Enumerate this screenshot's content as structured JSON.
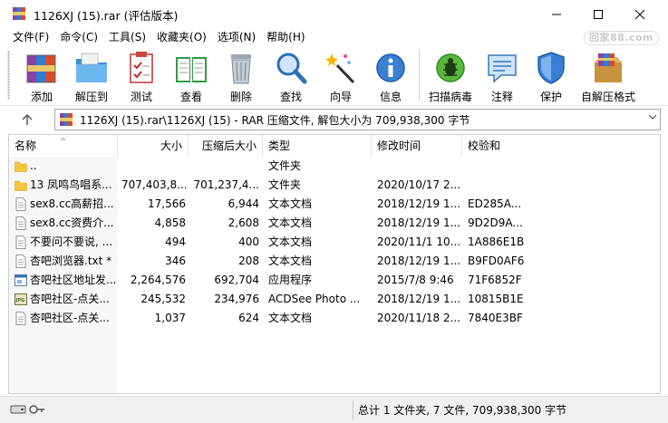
{
  "window": {
    "title": "1126XJ (15).rar (评估版本)",
    "watermark": "回家88.com"
  },
  "menu": [
    "文件(F)",
    "命令(C)",
    "工具(S)",
    "收藏夹(O)",
    "选项(N)",
    "帮助(H)"
  ],
  "toolbar": [
    {
      "label": "添加",
      "icon": "add-archive-icon"
    },
    {
      "label": "解压到",
      "icon": "extract-to-icon"
    },
    {
      "label": "测试",
      "icon": "test-icon"
    },
    {
      "label": "查看",
      "icon": "view-icon"
    },
    {
      "label": "删除",
      "icon": "delete-icon"
    },
    {
      "label": "查找",
      "icon": "find-icon"
    },
    {
      "label": "向导",
      "icon": "wizard-icon"
    },
    {
      "label": "信息",
      "icon": "info-icon"
    },
    {
      "label": "扫描病毒",
      "icon": "virus-scan-icon"
    },
    {
      "label": "注释",
      "icon": "comment-icon"
    },
    {
      "label": "保护",
      "icon": "protect-icon"
    },
    {
      "label": "自解压格式",
      "icon": "sfx-icon"
    }
  ],
  "address": {
    "path": "1126XJ (15).rar\\1126XJ (15) - RAR 压缩文件, 解包大小为 709,938,300 字节"
  },
  "columns": {
    "name": "名称",
    "size": "大小",
    "packed": "压缩后大小",
    "type": "类型",
    "modified": "修改时间",
    "crc": "校验和"
  },
  "files": [
    {
      "name": "..",
      "size": "",
      "packed": "",
      "type": "文件夹",
      "modified": "",
      "crc": "",
      "icon": "folder-icon"
    },
    {
      "name": "13 凤鸣鸟唱系...",
      "size": "707,403,8...",
      "packed": "701,237,4...",
      "type": "文件夹",
      "modified": "2020/10/17 2...",
      "crc": "",
      "icon": "folder-icon"
    },
    {
      "name": "sex8.cc高薪招...",
      "size": "17,566",
      "packed": "6,944",
      "type": "文本文档",
      "modified": "2018/12/19 1...",
      "crc": "ED285A...",
      "icon": "text-file-icon"
    },
    {
      "name": "sex8.cc资费介...",
      "size": "4,858",
      "packed": "2,608",
      "type": "文本文档",
      "modified": "2018/12/19 1...",
      "crc": "9D2D9A...",
      "icon": "text-file-icon"
    },
    {
      "name": "不要问不要说, ...",
      "size": "494",
      "packed": "400",
      "type": "文本文档",
      "modified": "2020/11/1 10...",
      "crc": "1A886E1B",
      "icon": "text-file-icon"
    },
    {
      "name": "杏吧浏览器.txt *",
      "size": "346",
      "packed": "208",
      "type": "文本文档",
      "modified": "2018/12/19 1...",
      "crc": "B9FD0AF6",
      "icon": "text-file-icon"
    },
    {
      "name": "杏吧社区地址发...",
      "size": "2,264,576",
      "packed": "692,704",
      "type": "应用程序",
      "modified": "2015/7/8 9:46",
      "crc": "71F6852F",
      "icon": "app-file-icon"
    },
    {
      "name": "杏吧社区-点关...",
      "size": "245,532",
      "packed": "234,976",
      "type": "ACDSee Photo ...",
      "modified": "2018/12/19 1...",
      "crc": "10815B1E",
      "icon": "jpg-file-icon"
    },
    {
      "name": "杏吧社区-点关...",
      "size": "1,037",
      "packed": "624",
      "type": "文本文档",
      "modified": "2020/11/18 2...",
      "crc": "7840E3BF",
      "icon": "text-file-icon"
    }
  ],
  "status": {
    "summary": "总计 1 文件夹, 7 文件, 709,938,300 字节"
  }
}
